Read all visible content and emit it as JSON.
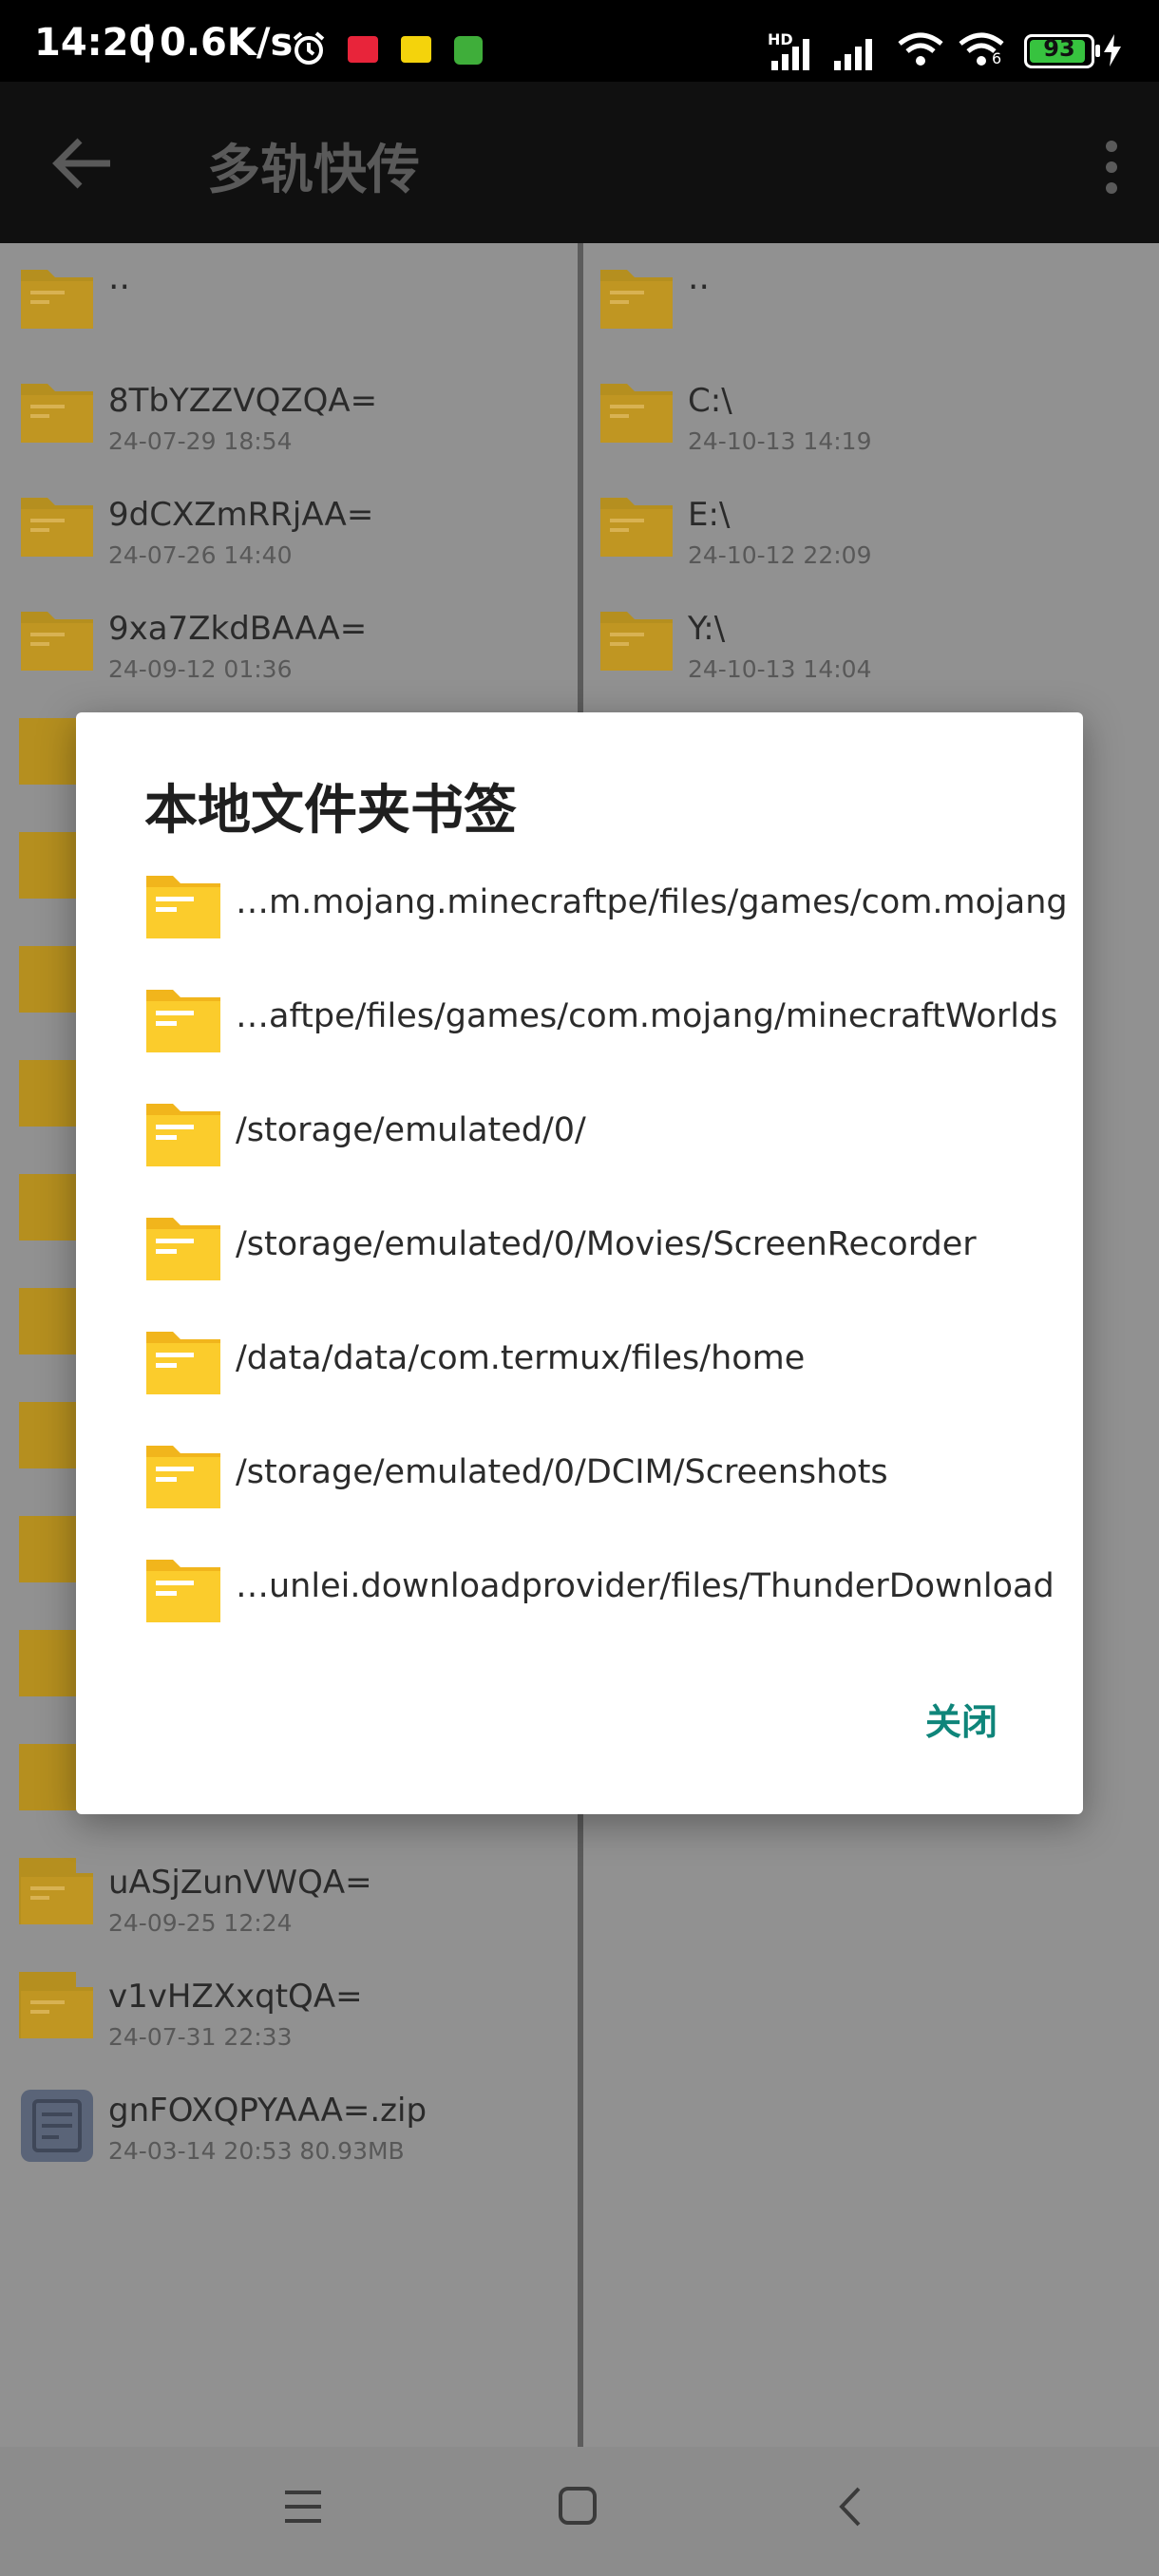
{
  "status": {
    "time": "14:20",
    "speed": "0.6K/s",
    "battery": "93",
    "hd": "HD",
    "wifi_num": "6"
  },
  "appbar": {
    "title": "多轨快传",
    "back_icon": "arrow-left-icon",
    "more_icon": "more-vert-icon"
  },
  "left_pane": {
    "items": [
      {
        "name": "..",
        "meta": ""
      },
      {
        "name": "8TbYZZVQZQA=",
        "meta": "24-07-29 18:54"
      },
      {
        "name": "9dCXZmRRjAA=",
        "meta": "24-07-26 14:40"
      },
      {
        "name": "9xa7ZkdBAAA=",
        "meta": "24-09-12 01:36"
      },
      {
        "name": "uASjZunVWQA=",
        "meta": "24-09-25 12:24"
      },
      {
        "name": "v1vHZXxqtQA=",
        "meta": "24-07-31 22:33"
      },
      {
        "name": "gnFOXQPYAAA=.zip",
        "meta": "24-03-14 20:53 80.93MB"
      }
    ]
  },
  "right_pane": {
    "items": [
      {
        "name": "..",
        "meta": ""
      },
      {
        "name": "C:\\",
        "meta": "24-10-13 14:19"
      },
      {
        "name": "E:\\",
        "meta": "24-10-12 22:09"
      },
      {
        "name": "Y:\\",
        "meta": "24-10-13 14:04"
      }
    ]
  },
  "dialog": {
    "title": "本地文件夹书签",
    "bookmarks": [
      "…m.mojang.minecraftpe/files/games/com.mojang",
      "…aftpe/files/games/com.mojang/minecraftWorlds",
      "/storage/emulated/0/",
      "/storage/emulated/0/Movies/ScreenRecorder",
      "/data/data/com.termux/files/home",
      "/storage/emulated/0/DCIM/Screenshots",
      "…unlei.downloadprovider/files/ThunderDownload"
    ],
    "close_label": "关闭"
  },
  "colors": {
    "folder": "#f1b51c",
    "accent": "#0f857a"
  }
}
